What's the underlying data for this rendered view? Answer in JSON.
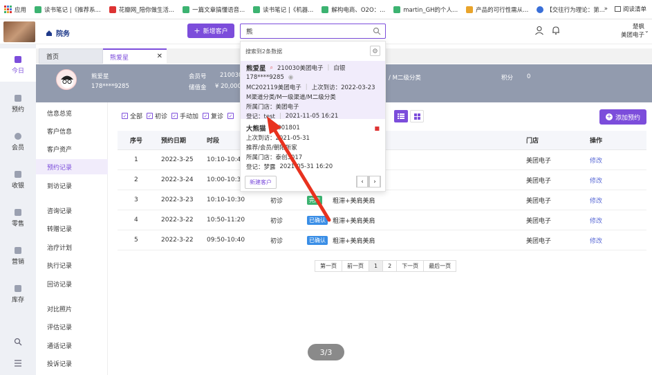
{
  "bookmarks": {
    "items": [
      {
        "label": "应用",
        "color": "#4a7bd8"
      },
      {
        "label": "读书笔记 |《推荐系...",
        "color": "#3cb371"
      },
      {
        "label": "花瓣网_陪你做生活...",
        "color": "#d33"
      },
      {
        "label": "一篇文章搞懂语音...",
        "color": "#3cb371"
      },
      {
        "label": "读书笔记 |《机器...",
        "color": "#3cb371"
      },
      {
        "label": "解构电商、O2O：...",
        "color": "#3cb371"
      },
      {
        "label": "martin_GH的个人...",
        "color": "#3cb371"
      },
      {
        "label": "产品的可行性需从...",
        "color": "#e9a42b"
      },
      {
        "label": "【交往行为理论：第...",
        "color": "#3a6fd8"
      }
    ],
    "more": "»",
    "reading_list": "阅读清单"
  },
  "header": {
    "brand": "院务",
    "new_customer": "新增客户",
    "search_value": "熊",
    "user_name": "楚枫",
    "user_org": "美团电子"
  },
  "leftnav": [
    {
      "label": "今日",
      "icon": "chart-icon",
      "active": true
    },
    {
      "label": "预约",
      "icon": "calendar-icon"
    },
    {
      "label": "会员",
      "icon": "users-icon"
    },
    {
      "label": "收银",
      "icon": "cash-icon"
    },
    {
      "label": "零售",
      "icon": "bag-icon"
    },
    {
      "label": "营销",
      "icon": "megaphone-icon"
    },
    {
      "label": "库存",
      "icon": "warehouse-icon"
    }
  ],
  "tabs": {
    "home": "首页",
    "current": "熊爱星"
  },
  "band": {
    "name": "熊爱星",
    "phone": "178****9285",
    "member_label": "会员号",
    "member_value": "210030",
    "stored_label": "储值金",
    "stored_value": "¥ 20,000",
    "category": "/ M二级分类",
    "points_label": "积分",
    "points_value": "0"
  },
  "subnav": [
    "信息总览",
    "客户信息",
    "客户资产",
    "预约记录",
    "到访记录",
    "咨询记录",
    "转赠记录",
    "治疗计划",
    "执行记录",
    "回访记录",
    "对比照片",
    "评估记录",
    "通话记录",
    "投诉记录"
  ],
  "filters": [
    "全部",
    "初诊",
    "手动加",
    "复诊"
  ],
  "add_appointment": "添加预约",
  "table": {
    "headers": {
      "seq": "序号",
      "date": "预约日期",
      "time": "时段",
      "store": "门店",
      "action": "操作"
    },
    "rows": [
      {
        "seq": "1",
        "date": "2022-3-25",
        "time": "10:10-10:40",
        "type": "",
        "status": "",
        "status_color": "",
        "item": "",
        "store": "美团电子",
        "action": "修改"
      },
      {
        "seq": "2",
        "date": "2022-3-24",
        "time": "10:00-10:30",
        "type": "",
        "status": "",
        "status_color": "",
        "item": "",
        "store": "美团电子",
        "action": "修改"
      },
      {
        "seq": "3",
        "date": "2022-3-23",
        "time": "10:10-10:30",
        "type": "初诊",
        "status": "完成",
        "status_color": "#3cb371",
        "item": "粗滞+美肩美肩",
        "store": "美团电子",
        "action": "修改"
      },
      {
        "seq": "4",
        "date": "2022-3-22",
        "time": "10:50-11:20",
        "type": "初诊",
        "status": "已确认",
        "status_color": "#3a8ee6",
        "item": "粗滞+美肩美肩",
        "store": "美团电子",
        "action": "修改"
      },
      {
        "seq": "5",
        "date": "2022-3-22",
        "time": "09:50-10:40",
        "type": "初诊",
        "status": "已确认",
        "status_color": "#3a8ee6",
        "item": "粗滞+美肩美肩",
        "store": "美团电子",
        "action": "修改"
      }
    ]
  },
  "pager": [
    "第一页",
    "前一页",
    "1",
    "2",
    "下一页",
    "最后一页"
  ],
  "dropdown": {
    "header": "搜索到2条数据",
    "result1": {
      "name": "熊爱星",
      "code": "210030美团电子",
      "level": "白银",
      "phone": "178****9285",
      "mc": "MC202119美团电子",
      "last_visit": "上次到访：2022-03-23",
      "channel": "M渠道分类/M一级渠道/M二级分类",
      "store": "所属门店：美团电子",
      "register": "登记：test",
      "register_time": "2021-11-05 16:21"
    },
    "result2": {
      "name": "大熊猫",
      "code": "21001801",
      "last_visit": "上次到访：2021-05-31",
      "channel": "推荐/会员/朝阳所家",
      "store": "所属门店：泰创3017",
      "register": "登记：梦露",
      "register_time": "2021-05-31 16:20"
    },
    "new_customer": "新建客户"
  },
  "counter": "3/3"
}
